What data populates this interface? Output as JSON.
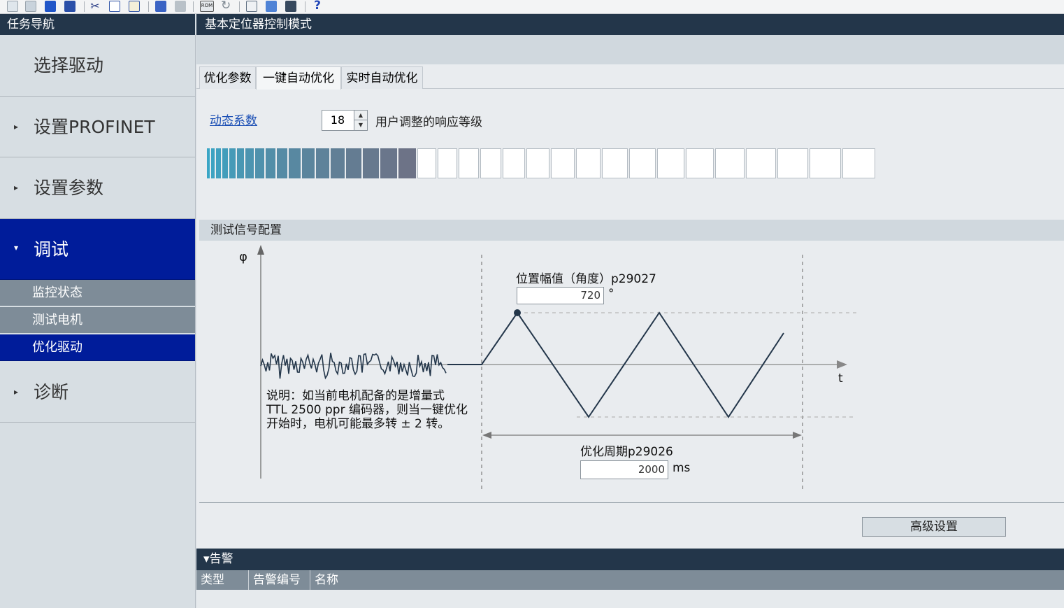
{
  "toolbar": {
    "icons": [
      "new-icon",
      "open-icon",
      "save-icon",
      "print-icon",
      "cut-icon",
      "copy-icon",
      "paste-icon",
      "connect-icon",
      "disconnect-icon",
      "rom-icon",
      "refresh-icon",
      "table-icon",
      "chart-icon",
      "device-icon",
      "help-icon"
    ],
    "rom_label": "ROM",
    "help_label": "?"
  },
  "nav": {
    "title": "任务导航",
    "items": [
      {
        "label": "选择驱动",
        "arrow": ""
      },
      {
        "label": "设置PROFINET",
        "arrow": "▸"
      },
      {
        "label": "设置参数",
        "arrow": "▸"
      },
      {
        "label": "调试",
        "arrow": "▾"
      },
      {
        "label": "诊断",
        "arrow": "▸"
      }
    ],
    "subitems": [
      "监控状态",
      "测试电机",
      "优化驱动"
    ]
  },
  "content": {
    "title": "基本定位器控制模式",
    "tabs": [
      "优化参数",
      "一键自动优化",
      "实时自动优化"
    ],
    "dynamic_label": "动态系数",
    "dynamic_value": "18",
    "dynamic_note": "用户调整的响应等级",
    "level_bar": {
      "filled": 18,
      "total": 35
    },
    "test_signal_title": "测试信号配置",
    "axis_y": "φ",
    "axis_x": "t",
    "amplitude_label": "位置幅值（角度）p29027",
    "amplitude_value": "720",
    "amplitude_unit": "°",
    "period_label": "优化周期p29026",
    "period_value": "2000",
    "period_unit": "ms",
    "note_lines": [
      "说明：如当前电机配备的是增量式",
      "TTL 2500 ppr 编码器，则当一键优化",
      "开始时，电机可能最多转 ± 2 转。"
    ],
    "advanced_button": "高级设置"
  },
  "alarm": {
    "title": "告警",
    "arrow": "▾",
    "columns": [
      "类型",
      "告警编号",
      "名称"
    ]
  },
  "colors": {
    "header_bg": "#23364a",
    "active_blue": "#001c9a",
    "link": "#1b4fb5",
    "bar_start": "#3aa6c6",
    "bar_end": "#6d7387"
  }
}
